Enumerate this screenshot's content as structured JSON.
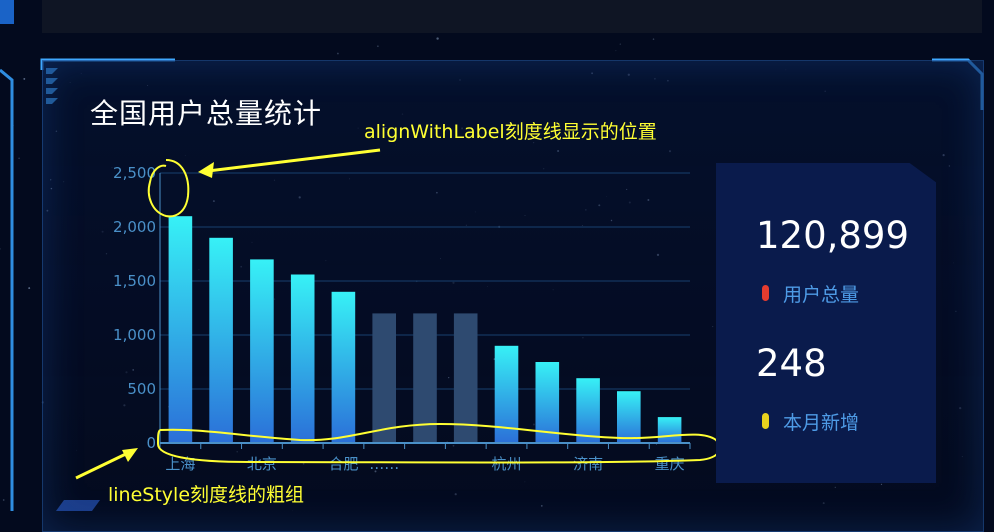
{
  "panel": {
    "title": "全国用户总量统计"
  },
  "stats": [
    {
      "value": "120,899",
      "label": "用户总量",
      "dot_color": "#e53c2f"
    },
    {
      "value": "248",
      "label": "本月新增",
      "dot_color": "#e8d21e"
    }
  ],
  "annotations": {
    "top": "alignWithLabel刻度线显示的位置",
    "bottom": "lineStyle刻度线的粗组",
    "color": "#ffff33"
  },
  "chart_data": {
    "type": "bar",
    "categories": [
      "上海",
      "",
      "北京",
      "",
      "合肥",
      "……",
      "",
      "",
      "杭州",
      "",
      "济南",
      "",
      "重庆"
    ],
    "values": [
      2100,
      1900,
      1700,
      1560,
      1400,
      1200,
      1200,
      1200,
      900,
      750,
      600,
      480,
      240
    ],
    "ylim": [
      0,
      2500
    ],
    "yticks": [
      0,
      500,
      1000,
      1500,
      2000,
      2500
    ],
    "ytick_labels": [
      "0",
      "500",
      "1,000",
      "1,500",
      "2,000",
      "2,500"
    ],
    "grid": true,
    "bar_colors": {
      "gradient_top": "#37f1f6",
      "gradient_bottom": "#2b6fd8",
      "muted": "#2e4a70"
    },
    "muted_indices": [
      5,
      6,
      7
    ],
    "axis_color": "#4a90c8"
  }
}
